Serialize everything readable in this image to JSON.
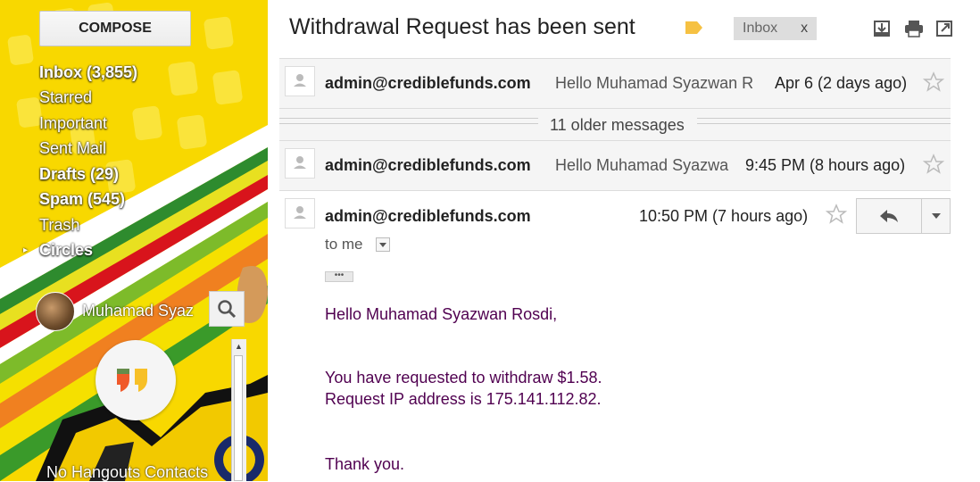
{
  "sidebar": {
    "compose_label": "COMPOSE",
    "nav": [
      {
        "label": "Inbox (3,855)",
        "bold": true
      },
      {
        "label": "Starred",
        "bold": false
      },
      {
        "label": "Important",
        "bold": false
      },
      {
        "label": "Sent Mail",
        "bold": false
      },
      {
        "label": "Drafts (29)",
        "bold": true
      },
      {
        "label": "Spam (545)",
        "bold": true
      },
      {
        "label": "Trash",
        "bold": false
      },
      {
        "label": "Circles",
        "bold": true
      }
    ],
    "hangouts": {
      "user_name": "Muhamad Syaz",
      "empty_text": "No Hangouts Contacts"
    }
  },
  "thread": {
    "subject": "Withdrawal Request has been sent",
    "label_chip": "Inbox",
    "label_chip_remove": "x",
    "collapsed": [
      {
        "sender": "admin@crediblefunds.com",
        "snippet": "Hello Muhamad Syazwan R",
        "date": "Apr 6 (2 days ago)"
      },
      {
        "sender": "admin@crediblefunds.com",
        "snippet": "Hello Muhamad Syazwa",
        "date": "9:45 PM (8 hours ago)"
      }
    ],
    "older_messages": "11 older messages",
    "open_message": {
      "sender": "admin@crediblefunds.com",
      "date": "10:50 PM (7 hours ago)",
      "to": "to me",
      "body": [
        "Hello Muhamad Syazwan Rosdi,",
        "You have requested to withdraw $1.58.",
        "Request IP address is 175.141.112.82.",
        "Thank you."
      ]
    }
  },
  "colors": {
    "theme_yellow": "#f8d800",
    "body_text": "#500050",
    "label_tag": "#f6c142"
  },
  "icons": [
    "label-icon",
    "download-icon",
    "print-icon",
    "new-window-icon",
    "star-icon",
    "reply-icon",
    "dropdown-icon",
    "search-icon",
    "hangouts-icon",
    "person-icon"
  ]
}
